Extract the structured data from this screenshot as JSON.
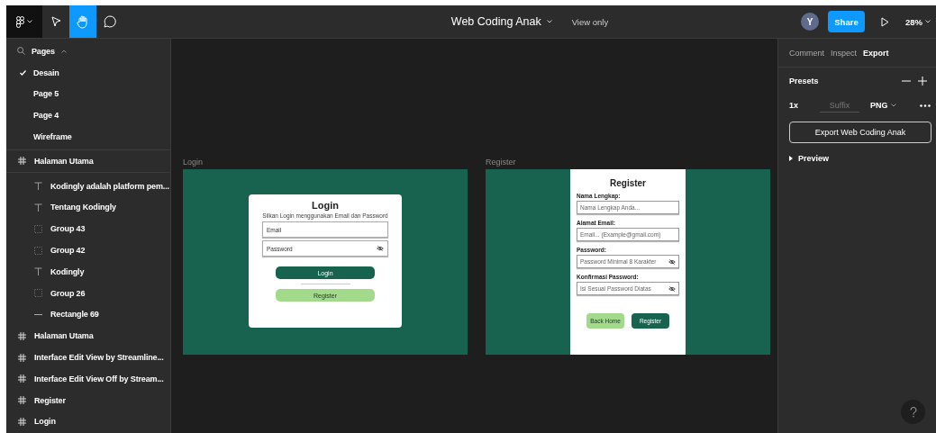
{
  "toolbar": {
    "tools": [
      {
        "kind": "menu",
        "selected": false
      },
      {
        "kind": "move",
        "selected": false
      },
      {
        "kind": "hand",
        "selected": true
      },
      {
        "kind": "comment",
        "selected": false
      }
    ],
    "file_title": "Web Coding Anak",
    "mode": "View only",
    "avatar": "Y",
    "share": "Share",
    "zoom": "28%"
  },
  "sidebar": {
    "pages_header": "Pages",
    "pages": [
      {
        "label": "Desain",
        "selected": true
      },
      {
        "label": "Page 5",
        "selected": false
      },
      {
        "label": "Page 4",
        "selected": false
      },
      {
        "label": "Wireframe",
        "selected": false
      }
    ],
    "layers": [
      {
        "kind": "frame",
        "name": "Halaman Utama",
        "children": [
          {
            "kind": "text",
            "name": "Kodingly adalah platform pem..."
          },
          {
            "kind": "text",
            "name": "Tentang Kodingly"
          },
          {
            "kind": "group",
            "name": "Group 43"
          },
          {
            "kind": "group",
            "name": "Group 42"
          },
          {
            "kind": "text",
            "name": "Kodingly"
          },
          {
            "kind": "group",
            "name": "Group 26"
          },
          {
            "kind": "line",
            "name": "Rectangle 69"
          }
        ]
      },
      {
        "kind": "frame",
        "name": "Halaman Utama"
      },
      {
        "kind": "frame",
        "name": "Interface Edit View by Streamline..."
      },
      {
        "kind": "frame",
        "name": "Interface Edit View Off by Stream..."
      },
      {
        "kind": "frame",
        "name": "Register"
      },
      {
        "kind": "frame",
        "name": "Login"
      }
    ]
  },
  "canvas": {
    "frames": [
      {
        "kind": "login",
        "label": "Login",
        "title": "Login",
        "subtitle": "Silkan Login menggunakan Email dan Password",
        "fields": [
          {
            "placeholder": "Email",
            "password": false
          },
          {
            "placeholder": "Password",
            "password": true
          }
        ],
        "buttons": [
          {
            "label": "Login",
            "kind": "primary"
          },
          {
            "label": "Register",
            "kind": "secondary"
          }
        ]
      },
      {
        "kind": "register",
        "label": "Register",
        "title": "Register",
        "fields": [
          {
            "label": "Nama Lengkap:",
            "placeholder": "Nama Lengkap Anda...",
            "password": false
          },
          {
            "label": "Alamat Email:",
            "placeholder": "Email... (Example@gmail.com)",
            "password": false
          },
          {
            "label": "Password:",
            "placeholder": "Password Minimal 8 Karakter",
            "password": true
          },
          {
            "label": "Konfirmasi Password:",
            "placeholder": "Isi Sesuai Password Diatas",
            "password": true
          }
        ],
        "buttons": [
          {
            "label": "Back Home",
            "kind": "secondary"
          },
          {
            "label": "Register",
            "kind": "primary"
          }
        ]
      }
    ]
  },
  "panel": {
    "tabs": [
      {
        "label": "Comment",
        "selected": false
      },
      {
        "label": "Inspect",
        "selected": false
      },
      {
        "label": "Export",
        "selected": true
      }
    ],
    "presets": "Presets",
    "scale": "1x",
    "suffix_placeholder": "Suffix",
    "format": "PNG",
    "export_button": "Export Web Coding Anak",
    "preview": "Preview"
  }
}
